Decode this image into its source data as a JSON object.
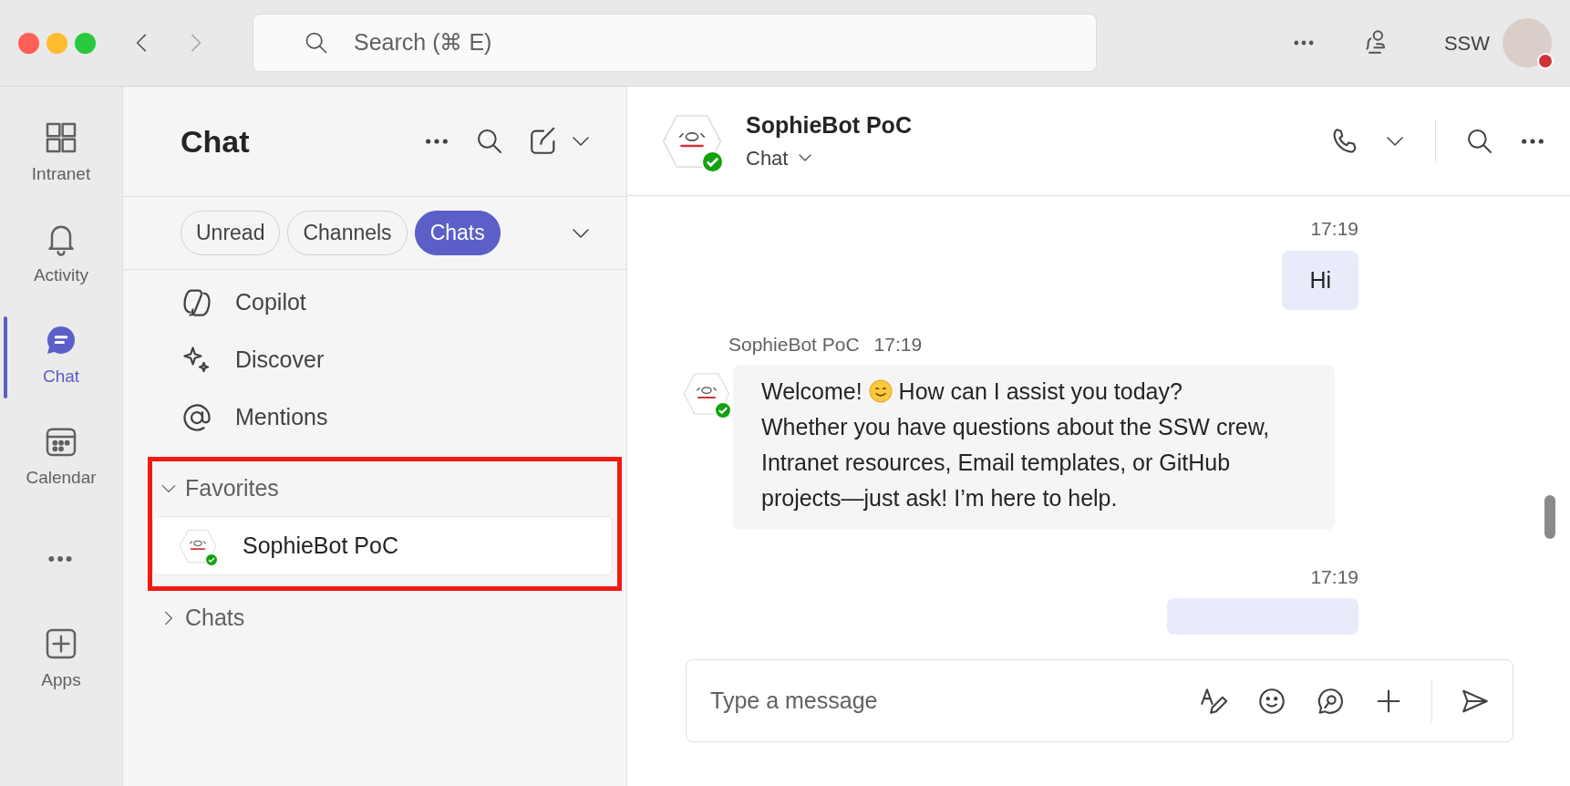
{
  "titlebar": {
    "search": {
      "placeholder": "Search (⌘ E)"
    },
    "account": "SSW",
    "busy": true
  },
  "rail": [
    {
      "label": "Intranet",
      "selected": false
    },
    {
      "label": "Activity",
      "selected": false
    },
    {
      "label": "Chat",
      "selected": true
    },
    {
      "label": "Calendar",
      "selected": false
    },
    {
      "label": "•••",
      "selected": false,
      "kind": "more"
    },
    {
      "label": "Apps",
      "selected": false
    }
  ],
  "chat_panel": {
    "title": "Chat",
    "filters": [
      {
        "label": "Unread",
        "selected": false
      },
      {
        "label": "Channels",
        "selected": false
      },
      {
        "label": "Chats",
        "selected": true
      }
    ],
    "shortcuts": [
      {
        "label": "Copilot"
      },
      {
        "label": "Discover"
      },
      {
        "label": "Mentions"
      }
    ],
    "sections": [
      {
        "label": "Favorites",
        "expanded": true,
        "highlighted": true,
        "children": [
          {
            "name": "SophieBot PoC",
            "selected": true,
            "available": true
          }
        ]
      },
      {
        "label": "Chats",
        "expanded": false,
        "highlighted": false
      }
    ]
  },
  "conversation": {
    "name": "SophieBot PoC",
    "subtitle": "Chat",
    "available": true,
    "messages": [
      {
        "kind": "sent",
        "time": "17:19",
        "text": "Hi"
      },
      {
        "kind": "received",
        "sender": "SophieBot PoC",
        "time": "17:19",
        "text_before_emoji": "Welcome!",
        "text_after_emoji": "How can I assist you today? Whether you have questions about the SSW crew, Intranet resources, Email templates, or GitHub projects—just ask! I’m here to help."
      },
      {
        "kind": "sent",
        "time": "17:19"
      }
    ],
    "composer": {
      "placeholder": "Type a message"
    }
  }
}
